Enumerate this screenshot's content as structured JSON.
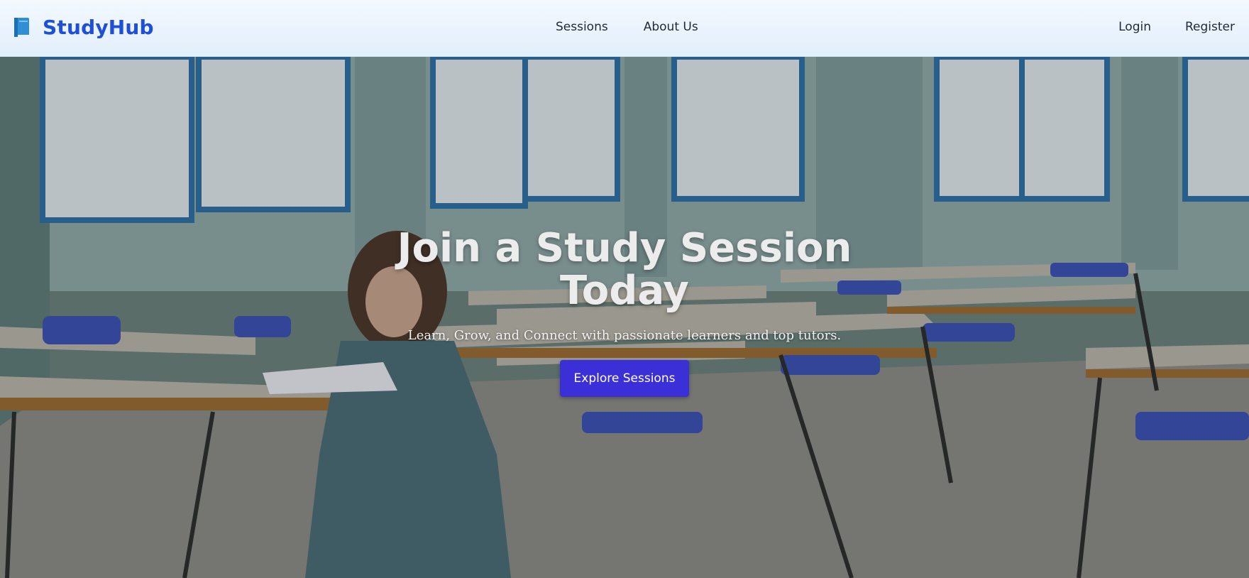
{
  "header": {
    "brand": "StudyHub",
    "brand_icon": "book-icon",
    "nav": [
      {
        "label": "Sessions"
      },
      {
        "label": "About Us"
      }
    ],
    "auth": [
      {
        "label": "Login"
      },
      {
        "label": "Register"
      }
    ]
  },
  "hero": {
    "title_line1": "Join a Study Session",
    "title_line2": "Today",
    "subtitle": "Learn, Grow, and Connect with passionate learners and top tutors.",
    "cta_label": "Explore Sessions",
    "background": "classroom-photo"
  },
  "colors": {
    "brand": "#1d4fd8",
    "cta": "#3b2fd8",
    "navbar": "#e8f2fd"
  }
}
